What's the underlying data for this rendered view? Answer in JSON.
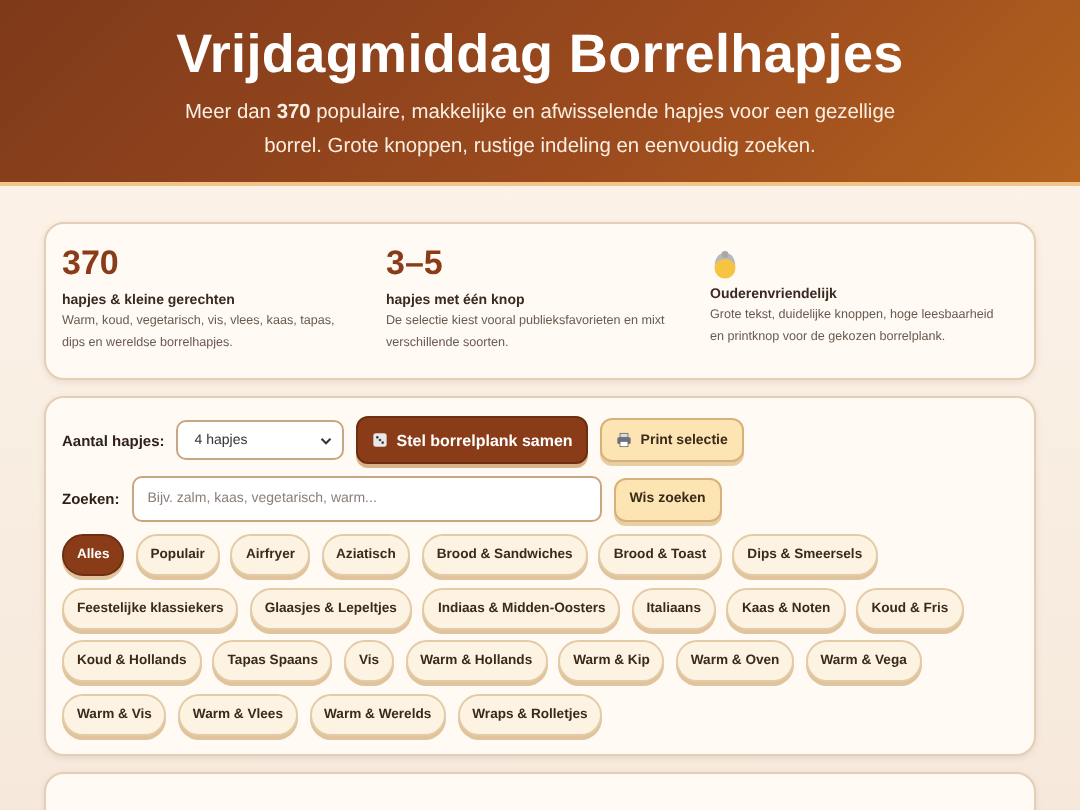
{
  "header": {
    "title": "Vrijdagmiddag Borrelhapjes",
    "subtitle": "Meer dan **370** populaire, makkelijke en afwisselende hapjes voor een gezellige borrel. Grote knoppen, rustige indeling en eenvoudig zoeken."
  },
  "stats": [
    {
      "kind": "number",
      "value": "370",
      "label": "hapjes & kleine gerechten",
      "text": "Warm, koud, vegetarisch, vis, vlees, kaas, tapas, dips en wereldse borrelhapjes."
    },
    {
      "kind": "number",
      "value": "3–5",
      "label": "hapjes met één knop",
      "text": "De selectie kiest vooral publieksfavorieten en mixt verschillende soorten."
    },
    {
      "kind": "icon",
      "label": "Ouderenvriendelijk",
      "text": "Grote tekst, duidelijke knoppen, hoge leesbaarheid en printknop voor de gekozen borrelplank."
    }
  ],
  "controls": {
    "count_label": "Aantal hapjes:",
    "count_value": "4 hapjes",
    "compose_button": "Stel borrelplank samen",
    "print_button": "Print selectie",
    "search_label": "Zoeken:",
    "search_placeholder": "Bijv. zalm, kaas, vegetarisch, warm...",
    "clear_button": "Wis zoeken"
  },
  "categories": [
    {
      "label": "Alles",
      "selected": true
    },
    {
      "label": "Populair",
      "selected": false
    },
    {
      "label": "Airfryer",
      "selected": false
    },
    {
      "label": "Aziatisch",
      "selected": false
    },
    {
      "label": "Brood & Sandwiches",
      "selected": false
    },
    {
      "label": "Brood & Toast",
      "selected": false
    },
    {
      "label": "Dips & Smeersels",
      "selected": false
    },
    {
      "label": "Feestelijke klassiekers",
      "selected": false
    },
    {
      "label": "Glaasjes & Lepeltjes",
      "selected": false
    },
    {
      "label": "Indiaas & Midden-Oosters",
      "selected": false
    },
    {
      "label": "Italiaans",
      "selected": false
    },
    {
      "label": "Kaas & Noten",
      "selected": false
    },
    {
      "label": "Koud & Fris",
      "selected": false
    },
    {
      "label": "Koud & Hollands",
      "selected": false
    },
    {
      "label": "Tapas Spaans",
      "selected": false
    },
    {
      "label": "Vis",
      "selected": false
    },
    {
      "label": "Warm & Hollands",
      "selected": false
    },
    {
      "label": "Warm & Kip",
      "selected": false
    },
    {
      "label": "Warm & Oven",
      "selected": false
    },
    {
      "label": "Warm & Vega",
      "selected": false
    },
    {
      "label": "Warm & Vis",
      "selected": false
    },
    {
      "label": "Warm & Vlees",
      "selected": false
    },
    {
      "label": "Warm & Werelds",
      "selected": false
    },
    {
      "label": "Wraps & Rolletjes",
      "selected": false
    }
  ]
}
